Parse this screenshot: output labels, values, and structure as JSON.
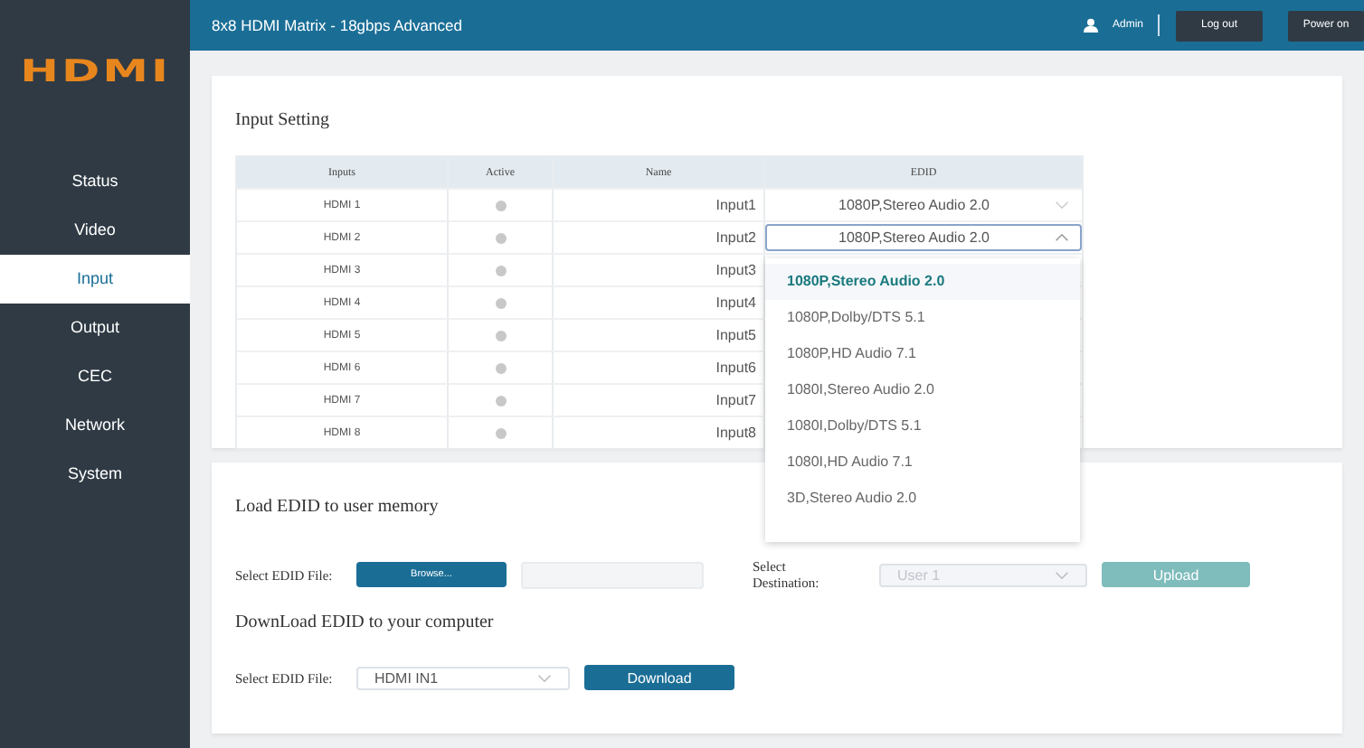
{
  "sidebar": {
    "logo": "HDMI",
    "items": [
      {
        "label": "Status",
        "selected": false
      },
      {
        "label": "Video",
        "selected": false
      },
      {
        "label": "Input",
        "selected": true
      },
      {
        "label": "Output",
        "selected": false
      },
      {
        "label": "CEC",
        "selected": false
      },
      {
        "label": "Network",
        "selected": false
      },
      {
        "label": "System",
        "selected": false
      }
    ]
  },
  "header": {
    "title": "8x8 HDMI Matrix - 18gbps Advanced",
    "user": "Admin",
    "buttons": [
      "Log out",
      "Power on"
    ]
  },
  "input_setting": {
    "title": "Input Setting",
    "columns": [
      "Inputs",
      "Active",
      "Name",
      "EDID"
    ],
    "rows": [
      {
        "input": "HDMI 1",
        "active": false,
        "name": "Input1",
        "edid": "1080P,Stereo Audio 2.0",
        "expanded": false
      },
      {
        "input": "HDMI 2",
        "active": false,
        "name": "Input2",
        "edid": "1080P,Stereo Audio 2.0",
        "expanded": true
      },
      {
        "input": "HDMI 3",
        "active": false,
        "name": "Input3"
      },
      {
        "input": "HDMI 4",
        "active": false,
        "name": "Input4"
      },
      {
        "input": "HDMI 5",
        "active": false,
        "name": "Input5"
      },
      {
        "input": "HDMI 6",
        "active": false,
        "name": "Input6"
      },
      {
        "input": "HDMI 7",
        "active": false,
        "name": "Input7"
      },
      {
        "input": "HDMI 8",
        "active": false,
        "name": "Input8"
      }
    ],
    "dropdown_options": [
      {
        "label": "1080P,Stereo Audio 2.0",
        "selected": true
      },
      {
        "label": "1080P,Dolby/DTS 5.1",
        "selected": false
      },
      {
        "label": "1080P,HD Audio 7.1",
        "selected": false
      },
      {
        "label": "1080I,Stereo Audio 2.0",
        "selected": false
      },
      {
        "label": "1080I,Dolby/DTS 5.1",
        "selected": false
      },
      {
        "label": "1080I,HD Audio 7.1",
        "selected": false
      },
      {
        "label": "3D,Stereo Audio 2.0",
        "selected": false
      }
    ]
  },
  "load_edid": {
    "title": "Load EDID to user memory",
    "file_label": "Select EDID File:",
    "browse_button": "Browse...",
    "destination_label": "Select Destination:",
    "destination": {
      "value": "User 1",
      "disabled": true
    },
    "upload_button": {
      "label": "Upload",
      "disabled": true
    }
  },
  "download_edid": {
    "title": "DownLoad EDID to your computer",
    "file_label": "Select EDID File:",
    "file": "HDMI IN1",
    "download_button": "Download"
  }
}
